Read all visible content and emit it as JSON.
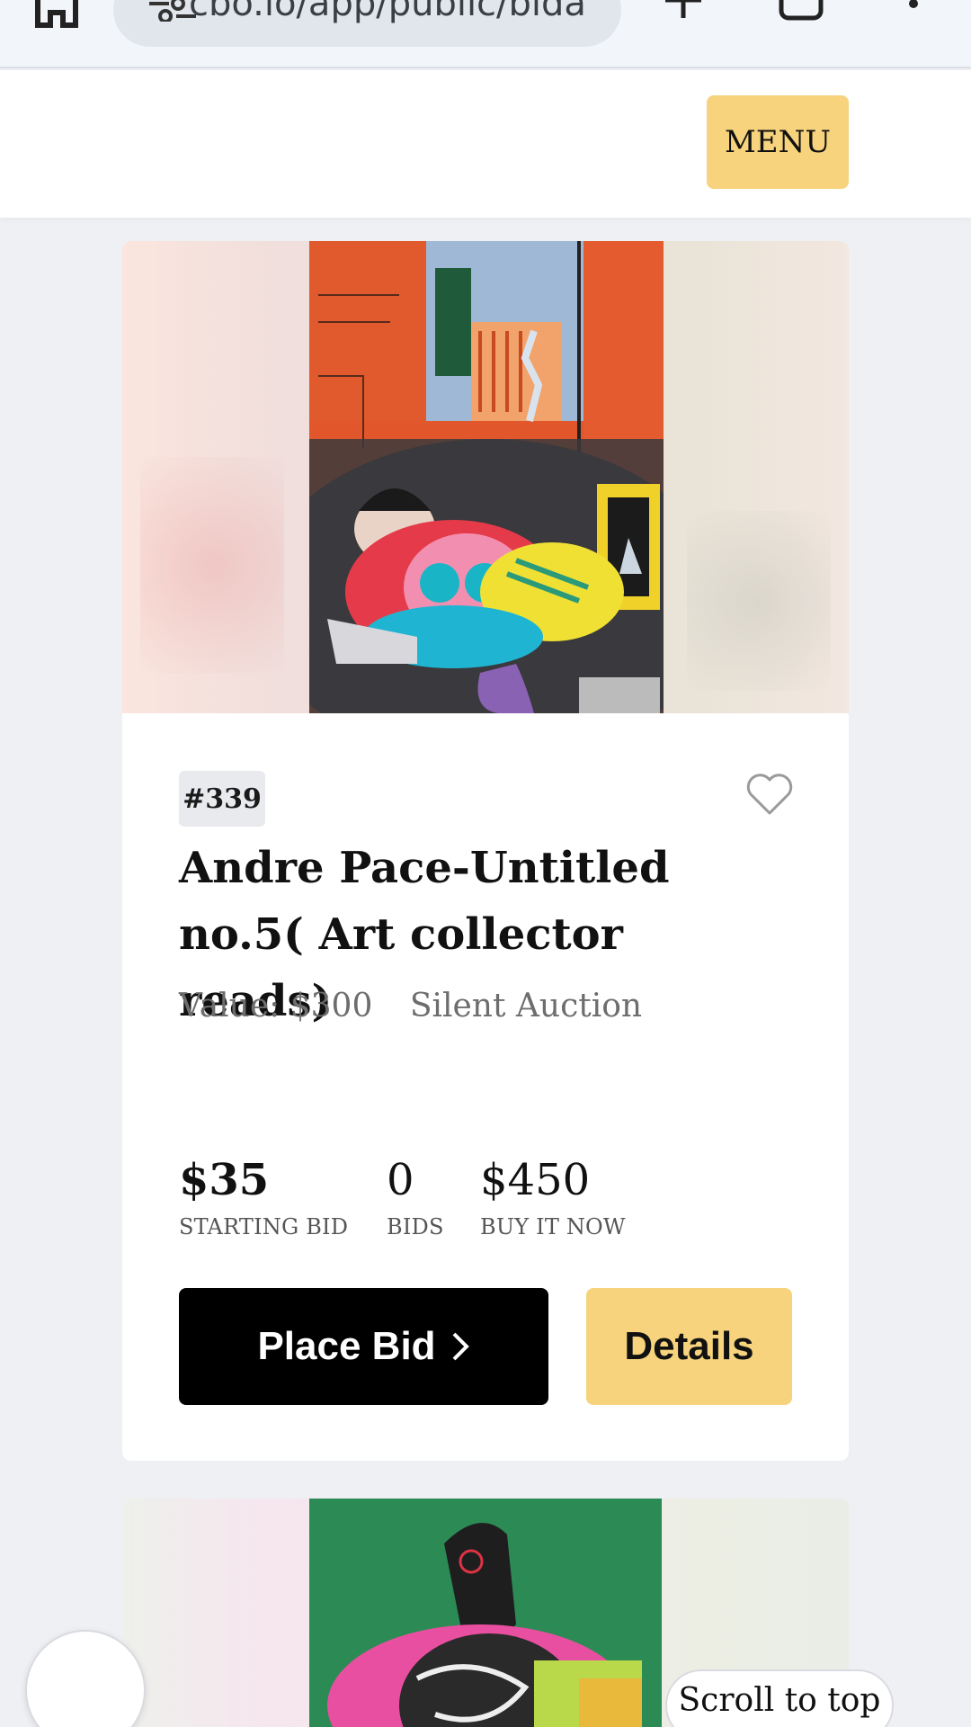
{
  "browser": {
    "url": "cbo.io/app/public/bida",
    "icons": [
      "home-icon",
      "site-settings-icon",
      "new-tab-icon",
      "tabs-icon",
      "more-options-icon"
    ]
  },
  "header": {
    "menu_label": "MENU"
  },
  "item": {
    "lot_number": "#339",
    "title": "Andre Pace-Untitled no.5( Art collector reads)",
    "value": "Value: $300",
    "auction_type": "Silent Auction",
    "stats": [
      {
        "value": "$35",
        "label": "STARTING BID"
      },
      {
        "value": "0",
        "label": "BIDS"
      },
      {
        "value": "$450",
        "label": "BUY IT NOW"
      }
    ],
    "place_bid_label": "Place Bid",
    "details_label": "Details"
  },
  "floating": {
    "scroll_to_top_label": "Scroll to top"
  },
  "colors": {
    "accent_yellow": "#f6d37c",
    "primary_black": "#000000",
    "page_background": "#eef0f4"
  }
}
